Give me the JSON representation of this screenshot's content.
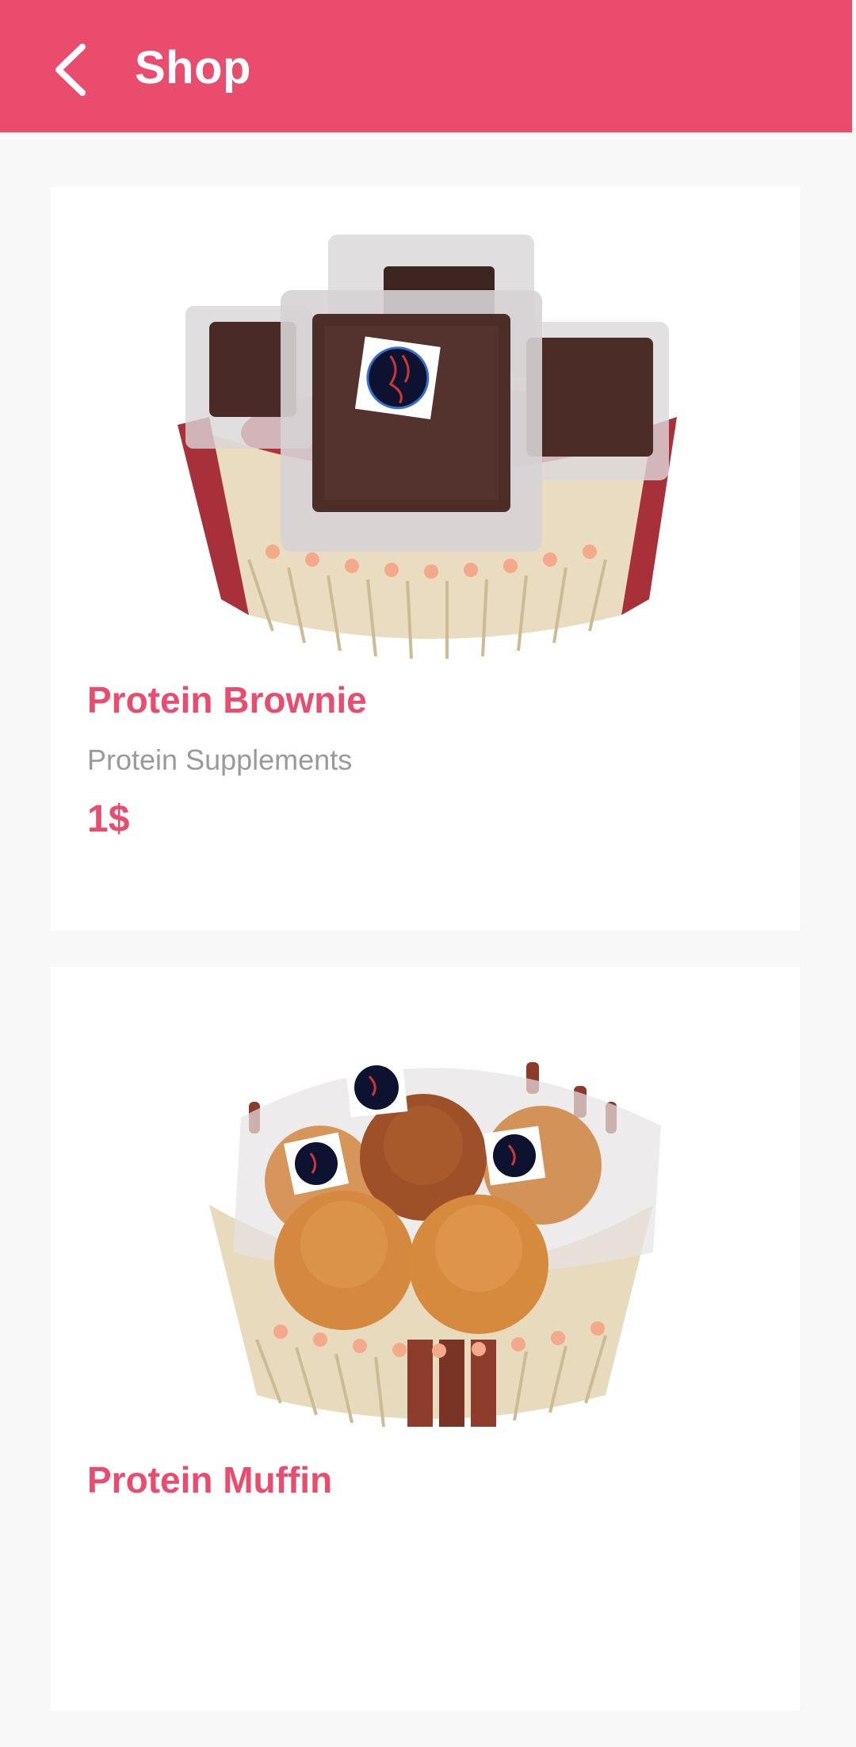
{
  "app_bar": {
    "title": "Shop",
    "back_icon": "chevron-left-icon",
    "background_color": "#e94c6d"
  },
  "products": [
    {
      "name": "Protein Brownie",
      "category": "Protein Supplements",
      "price": "1$",
      "image": "protein-brownie-basket-photo"
    },
    {
      "name": "Protein Muffin",
      "image": "protein-muffin-basket-photo"
    }
  ],
  "colors": {
    "accent": "#e94c6d",
    "secondary_text": "#9a9a9a",
    "page_background": "#f8f8f8",
    "card_background": "#ffffff"
  }
}
